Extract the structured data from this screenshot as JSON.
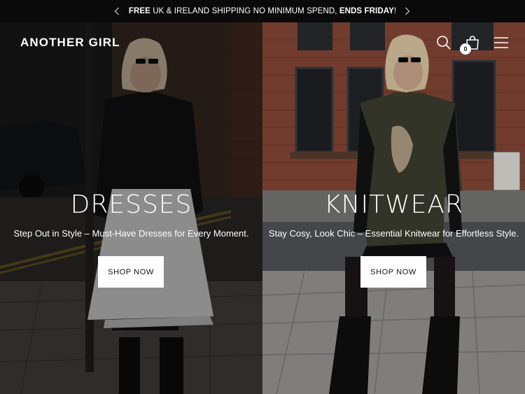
{
  "announcement": {
    "bold_start": "FREE",
    "middle": " UK & IRELAND SHIPPING NO MINIMUM SPEND, ",
    "bold_end": "ENDS FRIDAY",
    "suffix": "!"
  },
  "header": {
    "logo": "ANOTHER GIRL",
    "cart_count": "0"
  },
  "panels": [
    {
      "title": "DRESSES",
      "subtitle": "Step Out in Style – Must-Have Dresses for Every Moment.",
      "button": "SHOP NOW"
    },
    {
      "title": "KNITWEAR",
      "subtitle": "Stay Cosy, Look Chic – Essential Knitwear for Effortless Style.",
      "button": "SHOP NOW"
    }
  ],
  "colors": {
    "announcement_bg": "#0a0a0a",
    "button_bg": "#ffffff",
    "text": "#ffffff"
  },
  "icons": [
    "chevron-left-icon",
    "chevron-right-icon",
    "search-icon",
    "cart-icon",
    "menu-icon"
  ]
}
